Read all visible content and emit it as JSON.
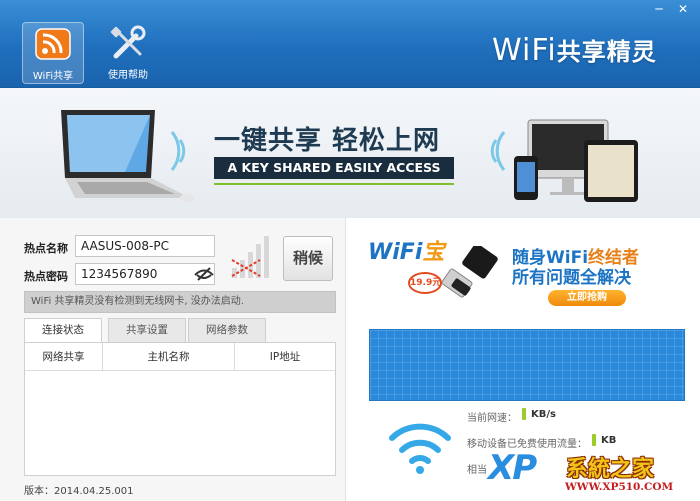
{
  "window": {
    "minimize_glyph": "─",
    "close_glyph": "✕"
  },
  "toolbar": {
    "items": [
      {
        "label": "WiFi共享",
        "icon": "rss-wifi-icon",
        "active": true
      },
      {
        "label": "使用帮助",
        "icon": "wrench-screwdriver-icon",
        "active": false
      }
    ]
  },
  "brand": {
    "wifi": "WiFi",
    "cn": "共享精灵"
  },
  "banner": {
    "title": "一键共享 轻松上网",
    "subtitle": "A KEY SHARED EASILY ACCESS"
  },
  "form": {
    "ssid_label": "热点名称",
    "ssid_value": "AASUS-008-PC",
    "password_label": "热点密码",
    "password_value": "1234567890",
    "start_button": "稍候",
    "status_message": "WiFi 共享精灵没有检测到无线网卡, 没办法启动."
  },
  "tabs": [
    {
      "label": "连接状态",
      "active": true
    },
    {
      "label": "共享设置",
      "active": false
    },
    {
      "label": "网络参数",
      "active": false
    }
  ],
  "table": {
    "columns": [
      "网络共享",
      "主机名称",
      "IP地址"
    ]
  },
  "version": "版本：2014.04.25.001",
  "ad": {
    "logo_main": "WiFi",
    "logo_accent": "宝",
    "line1_prefix": "随身WiFi",
    "line1_accent": "终结者",
    "line2": "所有问题全解决",
    "price": "19.9元",
    "buy_button": "立即抢购"
  },
  "stats": {
    "speed_label": "当前网速：",
    "speed_unit": "KB/s",
    "mobile_label": "移动设备已免费使用流量：",
    "mobile_unit": "KB",
    "saved_label": "相当"
  },
  "watermark": {
    "xp": "XP",
    "cn": "系統之家",
    "url": "WWW.XP510.COM"
  },
  "colors": {
    "header_blue": "#1f6fbd",
    "graph_blue": "#2b89dc",
    "accent_orange": "#f08a0c",
    "signal_green": "#9acd2a"
  }
}
